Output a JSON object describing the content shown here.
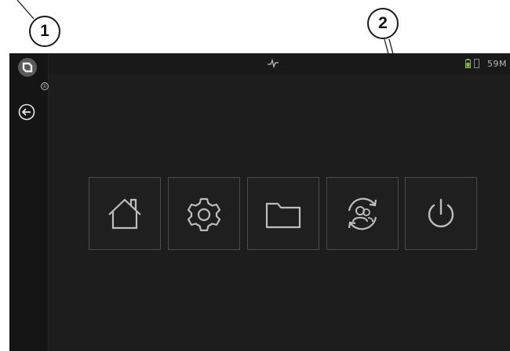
{
  "callouts": [
    {
      "label": "1"
    },
    {
      "label": "2"
    }
  ],
  "status_bar": {
    "time_text": "59M",
    "icons": [
      "activity-icon",
      "battery-icon",
      "sd-card-icon"
    ]
  },
  "sidebar": {
    "logo_icon": "app-logo-icon",
    "info_badge": "①",
    "back_icon": "back-arrow-icon"
  },
  "tiles": [
    {
      "icon": "home-icon"
    },
    {
      "icon": "settings-gear-icon"
    },
    {
      "icon": "folder-icon"
    },
    {
      "icon": "user-switch-icon"
    },
    {
      "icon": "power-icon"
    }
  ],
  "colors": {
    "screen_bg": "#1d1d1d",
    "tile_border": "#4a4a4a",
    "icon_stroke": "#bdbdbd",
    "battery": "#7fbf3f"
  }
}
